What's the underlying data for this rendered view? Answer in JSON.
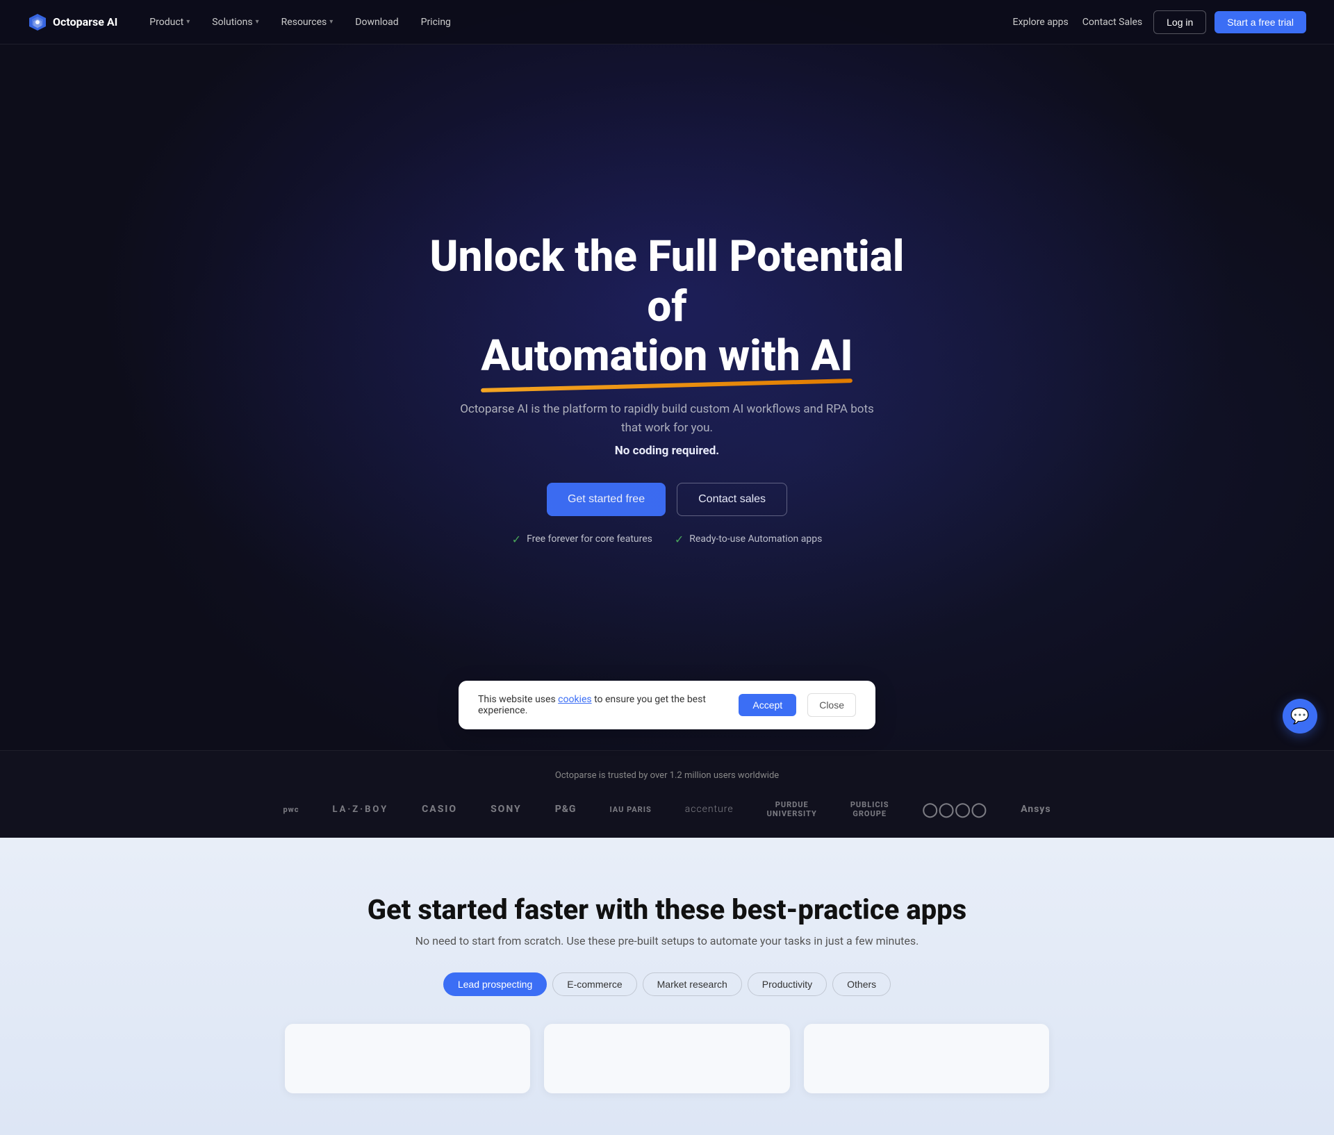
{
  "nav": {
    "logo_text": "Octoparse AI",
    "items": [
      {
        "label": "Product",
        "has_dropdown": true
      },
      {
        "label": "Solutions",
        "has_dropdown": true
      },
      {
        "label": "Resources",
        "has_dropdown": true
      },
      {
        "label": "Download",
        "has_dropdown": false
      },
      {
        "label": "Pricing",
        "has_dropdown": false
      }
    ],
    "right_links": [
      {
        "label": "Explore apps"
      },
      {
        "label": "Contact Sales"
      }
    ],
    "login_label": "Log in",
    "trial_label": "Start a free trial"
  },
  "hero": {
    "title_line1": "Unlock the Full Potential of",
    "title_line2": "Automation with AI",
    "subtitle": "Octoparse AI is the platform to rapidly build custom AI workflows and RPA bots that work for you.",
    "subtitle_bold": "No coding required.",
    "btn_primary": "Get started free",
    "btn_secondary": "Contact sales",
    "check1": "Free forever for core features",
    "check2": "Ready-to-use Automation apps"
  },
  "trusted": {
    "text": "Octoparse is trusted by over 1.2 million users worldwide",
    "logos": [
      "PWC",
      "LA-Z-BOY",
      "CASIO",
      "SONY",
      "P&G",
      "IAU PARIS",
      "accenture",
      "PURDUE UNIVERSITY",
      "PUBLICIS GROUPE",
      "AUDI",
      "Ansys"
    ]
  },
  "section2": {
    "title": "Get started faster with these best-practice apps",
    "subtitle": "No need to start from scratch. Use these pre-built setups to automate your tasks in just a few minutes.",
    "tabs": [
      {
        "label": "Lead prospecting",
        "active": true
      },
      {
        "label": "E-commerce"
      },
      {
        "label": "Market research"
      },
      {
        "label": "Productivity"
      },
      {
        "label": "Others"
      }
    ]
  },
  "cookie": {
    "text": "This website uses ",
    "link_text": "cookies",
    "text2": " to ensure you get the best experience.",
    "accept_label": "Accept",
    "close_label": "Close"
  }
}
